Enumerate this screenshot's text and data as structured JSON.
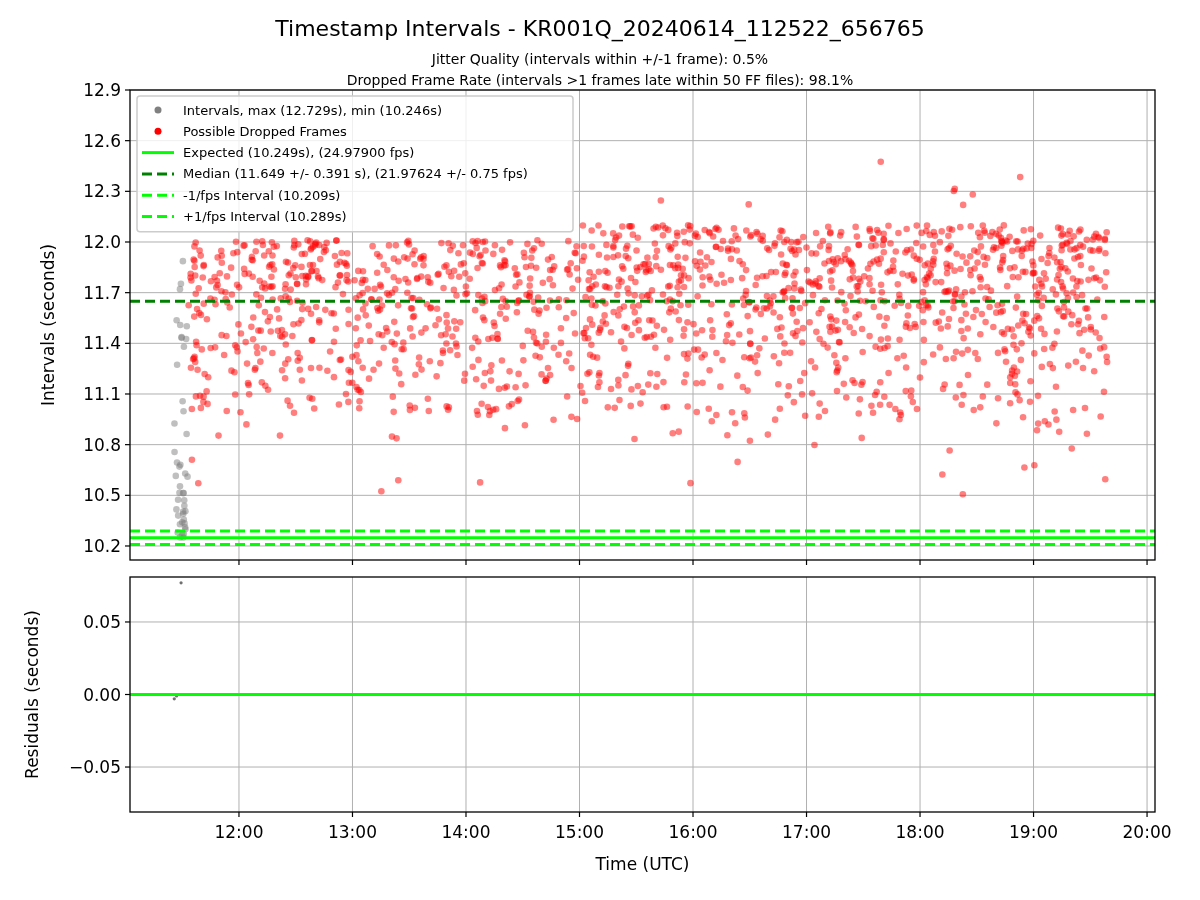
{
  "figure": {
    "title": "Timestamp Intervals - KR001Q_20240614_112522_656765",
    "subtitles": [
      "Jitter Quality (intervals within +/-1 frame): 0.5%",
      "Dropped Frame Rate (intervals >1 frames late within 50 FF files): 98.1%"
    ]
  },
  "intervals_plot": {
    "legend_markers": [
      {
        "label": "Intervals, max (12.729s), min (10.246s)",
        "color": "#808080"
      },
      {
        "label": "Possible Dropped Frames",
        "color": "#ff0000"
      }
    ],
    "chart_data": {
      "type": "line",
      "ylabel": "Intervals (seconds)",
      "x": [
        11.04,
        20.07
      ],
      "xlim": [
        11.04,
        20.07
      ],
      "ylim": [
        10.117,
        12.9
      ],
      "grid": true,
      "yticks": [
        {
          "value": 10.2,
          "label": "10.2"
        },
        {
          "value": 10.5,
          "label": "10.5"
        },
        {
          "value": 10.8,
          "label": "10.8"
        },
        {
          "value": 11.1,
          "label": "11.1"
        },
        {
          "value": 11.4,
          "label": "11.4"
        },
        {
          "value": 11.7,
          "label": "11.7"
        },
        {
          "value": 12.0,
          "label": "12.0"
        },
        {
          "value": 12.3,
          "label": "12.3"
        },
        {
          "value": 12.6,
          "label": "12.6"
        },
        {
          "value": 12.9,
          "label": "12.9"
        }
      ],
      "series": [
        {
          "name": "Expected (10.249s), (24.97900 fps)",
          "color": "#00ff00",
          "line_style": "solid",
          "values": [
            10.249,
            10.249
          ]
        },
        {
          "name": "Median (11.649 +/- 0.391 s), (21.97624 +/- 0.75 fps)",
          "color": "#008000",
          "line_style": "dashed",
          "values": [
            11.649,
            11.649
          ]
        },
        {
          "name": "-1/fps Interval (10.209s)",
          "color": "#00ff00",
          "line_style": "dashed",
          "values": [
            10.209,
            10.209
          ]
        },
        {
          "name": "+1/fps Interval (10.289s)",
          "color": "#00ff00",
          "line_style": "dashed",
          "values": [
            10.289,
            10.289
          ]
        }
      ]
    }
  },
  "residuals_plot": {
    "chart_data": {
      "type": "line",
      "grid": true,
      "xlabel": "Time (UTC)",
      "ylabel": "Residuals (seconds)",
      "x": [
        11.04,
        20.07
      ],
      "xlim": [
        11.04,
        20.07
      ],
      "ylim": [
        -0.081,
        0.081
      ],
      "xticks": [
        {
          "value": 12,
          "label": "12:00"
        },
        {
          "value": 13,
          "label": "13:00"
        },
        {
          "value": 14,
          "label": "14:00"
        },
        {
          "value": 15,
          "label": "15:00"
        },
        {
          "value": 16,
          "label": "16:00"
        },
        {
          "value": 17,
          "label": "17:00"
        },
        {
          "value": 18,
          "label": "18:00"
        },
        {
          "value": 19,
          "label": "19:00"
        },
        {
          "value": 20,
          "label": "20:00"
        }
      ],
      "yticks": [
        {
          "value": 0.05,
          "label": "0.05"
        },
        {
          "value": 0,
          "label": "0.00"
        },
        {
          "value": -0.05,
          "label": "−0.05"
        }
      ],
      "series": [
        {
          "color": "#00ff00",
          "line_style": "solid",
          "values": [
            0,
            0
          ]
        }
      ]
    }
  }
}
